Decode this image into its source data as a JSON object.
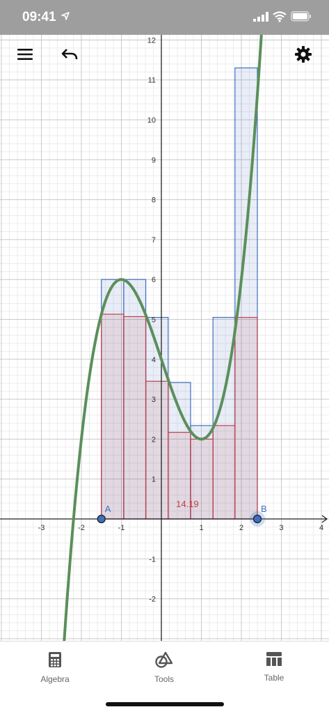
{
  "status_bar": {
    "time": "09:41"
  },
  "toolbar": {
    "menu_icon": "hamburger-menu-icon",
    "undo_icon": "undo-icon",
    "settings_icon": "gear-icon"
  },
  "graph": {
    "x_ticks": [
      "-3",
      "-2",
      "-1",
      "1",
      "2",
      "3",
      "4"
    ],
    "y_ticks": [
      "-2",
      "-1",
      "1",
      "2",
      "3",
      "4",
      "5",
      "6",
      "7",
      "8",
      "9",
      "10",
      "11",
      "12"
    ],
    "point_a": {
      "label": "A",
      "x": -1.5,
      "y": 0
    },
    "point_b": {
      "label": "B",
      "x": 2.4,
      "y": 0
    },
    "sum_label": "14.19",
    "function_color": "#5a8f5a",
    "upper_color": "#3f6fc0",
    "lower_color": "#c0404a",
    "upper_bars": [
      {
        "x0": -1.5,
        "x1": -0.94,
        "h": 6.0
      },
      {
        "x0": -0.94,
        "x1": -0.39,
        "h": 6.0
      },
      {
        "x0": -0.39,
        "x1": 0.17,
        "h": 5.05
      },
      {
        "x0": 0.17,
        "x1": 0.73,
        "h": 3.42
      },
      {
        "x0": 0.73,
        "x1": 1.29,
        "h": 2.34
      },
      {
        "x0": 1.29,
        "x1": 1.84,
        "h": 5.05
      },
      {
        "x0": 1.84,
        "x1": 2.4,
        "h": 11.3
      }
    ],
    "lower_bars": [
      {
        "x0": -1.5,
        "x1": -0.94,
        "h": 5.13
      },
      {
        "x0": -0.94,
        "x1": -0.39,
        "h": 5.07
      },
      {
        "x0": -0.39,
        "x1": 0.17,
        "h": 3.45
      },
      {
        "x0": 0.17,
        "x1": 0.73,
        "h": 2.17
      },
      {
        "x0": 0.73,
        "x1": 1.29,
        "h": 2.0
      },
      {
        "x0": 1.29,
        "x1": 1.84,
        "h": 2.34
      },
      {
        "x0": 1.84,
        "x1": 2.4,
        "h": 5.05
      }
    ]
  },
  "bottom_nav": {
    "algebra_label": "Algebra",
    "tools_label": "Tools",
    "table_label": "Table"
  }
}
